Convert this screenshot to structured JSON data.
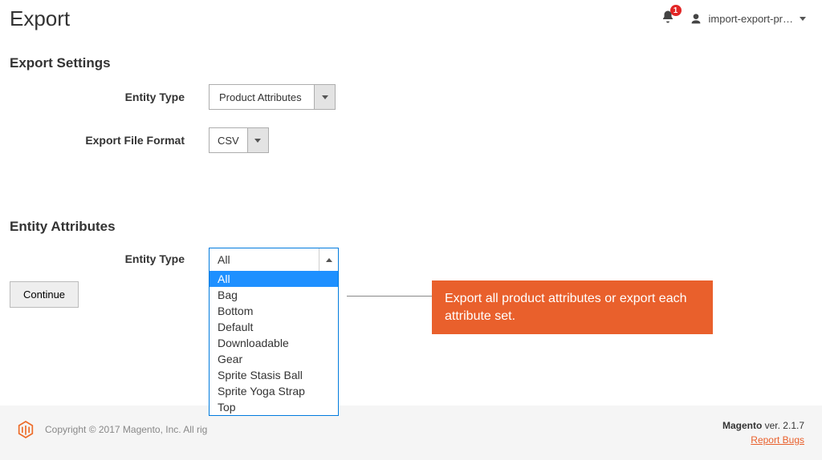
{
  "header": {
    "title": "Export",
    "notification_count": "1",
    "user_label": "import-export-pr…"
  },
  "export_settings": {
    "heading": "Export Settings",
    "entity_type_label": "Entity Type",
    "entity_type_value": "Product Attributes",
    "file_format_label": "Export File Format",
    "file_format_value": "CSV"
  },
  "entity_attributes": {
    "heading": "Entity Attributes",
    "entity_type_label": "Entity Type",
    "selected_value": "All",
    "options": [
      "All",
      "Bag",
      "Bottom",
      "Default",
      "Downloadable",
      "Gear",
      "Sprite Stasis Ball",
      "Sprite Yoga Strap",
      "Top"
    ]
  },
  "continue_label": "Continue",
  "callout": {
    "text": "Export all product attributes or export each attribute set."
  },
  "footer": {
    "copyright": "Copyright © 2017 Magento, Inc. All rig",
    "brand": "Magento",
    "version_text": " ver. 2.1.7",
    "report_bugs": "Report Bugs"
  }
}
